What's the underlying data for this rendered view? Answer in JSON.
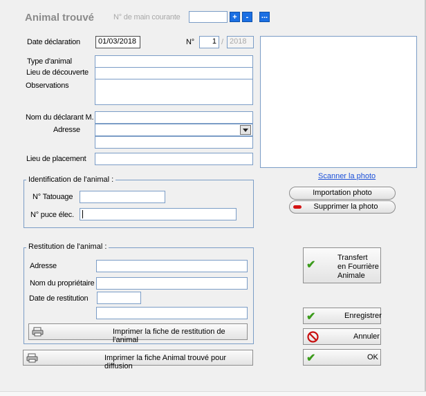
{
  "title": "Animal trouvé",
  "main_courante": {
    "label": "N° de main courante",
    "value": "",
    "plus": "+",
    "minus": "-",
    "more": "..."
  },
  "date_declaration": {
    "label": "Date déclaration",
    "value": "01/03/2018"
  },
  "numero": {
    "label": "N°",
    "value": "1",
    "separator": "/",
    "year": "2018"
  },
  "type_animal": {
    "label": "Type d'animal",
    "value": ""
  },
  "lieu_decouverte": {
    "label": "Lieu de découverte",
    "value": ""
  },
  "observations": {
    "label": "Observations",
    "value": ""
  },
  "nom_declarant": {
    "label": "Nom du déclarant M.",
    "value": ""
  },
  "adresse": {
    "label": "Adresse",
    "value": "",
    "value2": ""
  },
  "lieu_placement": {
    "label": "Lieu de placement",
    "value": ""
  },
  "identification": {
    "title": "Identification de l'animal :",
    "tatouage_label": "N° Tatouage",
    "tatouage_value": "",
    "puce_label": "N° puce élec.",
    "puce_value": ""
  },
  "restitution": {
    "title": "Restitution de l'animal :",
    "adresse_label": "Adresse",
    "adresse_value": "",
    "proprietaire_label": "Nom du propriétaire",
    "proprietaire_value": "",
    "date_label": "Date de restitution",
    "date_value": "",
    "extra_value": "",
    "print_label": "Imprimer la fiche de restitution de l'animal"
  },
  "print_diffusion_label": "Imprimer la fiche Animal trouvé pour diffusion",
  "photo": {
    "scan_link": "Scanner la photo",
    "import_label": "Importation photo",
    "delete_label": "Supprimer la photo"
  },
  "buttons": {
    "transfert_l1": "Transfert",
    "transfert_l2": "en Fourrière",
    "transfert_l3": "Animale",
    "save": "Enregistrer",
    "cancel": "Annuler",
    "ok": "OK"
  },
  "colors": {
    "accent": "#1b6fe3",
    "field_border": "#7a9cc6",
    "check": "#3b9b1b",
    "cancel": "#c81010"
  }
}
